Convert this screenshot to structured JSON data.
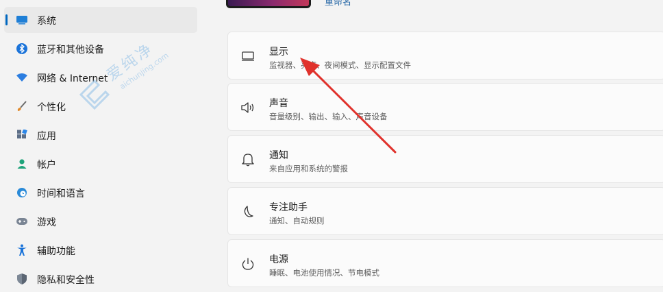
{
  "sidebar": {
    "items": [
      {
        "label": "系统",
        "icon": "monitor-icon",
        "active": true
      },
      {
        "label": "蓝牙和其他设备",
        "icon": "bluetooth-icon"
      },
      {
        "label": "网络 & Internet",
        "icon": "wifi-icon"
      },
      {
        "label": "个性化",
        "icon": "brush-icon"
      },
      {
        "label": "应用",
        "icon": "apps-icon"
      },
      {
        "label": "帐户",
        "icon": "person-icon"
      },
      {
        "label": "时间和语言",
        "icon": "globe-clock-icon"
      },
      {
        "label": "游戏",
        "icon": "gamepad-icon"
      },
      {
        "label": "辅助功能",
        "icon": "accessibility-icon"
      },
      {
        "label": "隐私和安全性",
        "icon": "shield-icon"
      }
    ]
  },
  "header": {
    "device_name": "重命名"
  },
  "watermark": {
    "cn": "爱纯净",
    "en": "aichunjing.com"
  },
  "settings": [
    {
      "title": "显示",
      "desc": "监视器、亮度、夜间模式、显示配置文件",
      "icon": "display-icon"
    },
    {
      "title": "声音",
      "desc": "音量级别、输出、输入、声音设备",
      "icon": "speaker-icon"
    },
    {
      "title": "通知",
      "desc": "来自应用和系统的警报",
      "icon": "bell-icon"
    },
    {
      "title": "专注助手",
      "desc": "通知、自动规则",
      "icon": "moon-icon"
    },
    {
      "title": "电源",
      "desc": "睡眠、电池使用情况、节电模式",
      "icon": "power-icon"
    }
  ],
  "colors": {
    "accent": "#0067c0",
    "annotation_arrow": "#e0322c"
  }
}
